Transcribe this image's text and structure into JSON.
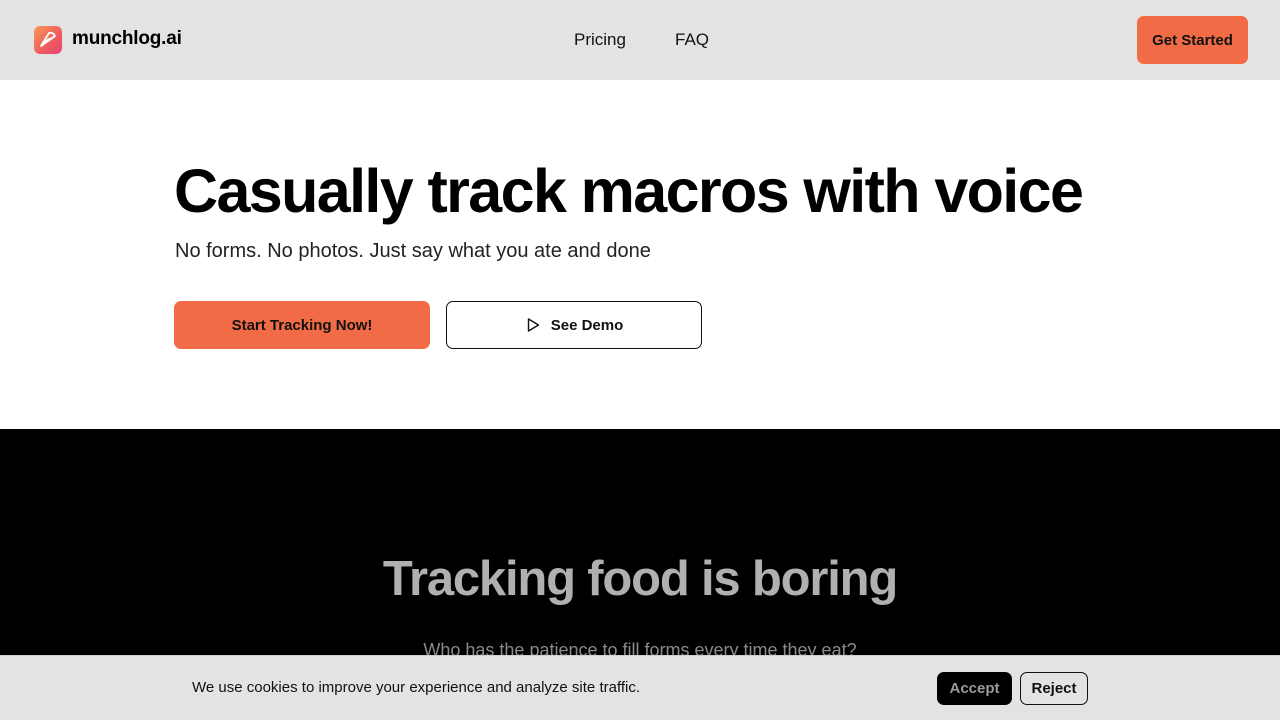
{
  "header": {
    "brand": "munchlog.ai",
    "logo_icon": "pizza-slice-icon",
    "nav": [
      {
        "label": "Pricing"
      },
      {
        "label": "FAQ"
      }
    ],
    "cta_label": "Get Started"
  },
  "hero": {
    "title": "Casually track macros with voice",
    "subtitle": "No forms. No photos. Just say what you ate and done",
    "primary_label": "Start Tracking Now!",
    "secondary_label": "See Demo",
    "secondary_icon": "play-icon"
  },
  "section_boring": {
    "title": "Tracking food is boring",
    "subtitle": "Who has the patience to fill forms every time they eat?"
  },
  "cookie_banner": {
    "text": "We use cookies to improve your experience and analyze site traffic.",
    "accept_label": "Accept",
    "reject_label": "Reject"
  },
  "colors": {
    "accent": "#f26b47",
    "header_bg": "#e3e3e3",
    "dark_bg": "#000000"
  }
}
